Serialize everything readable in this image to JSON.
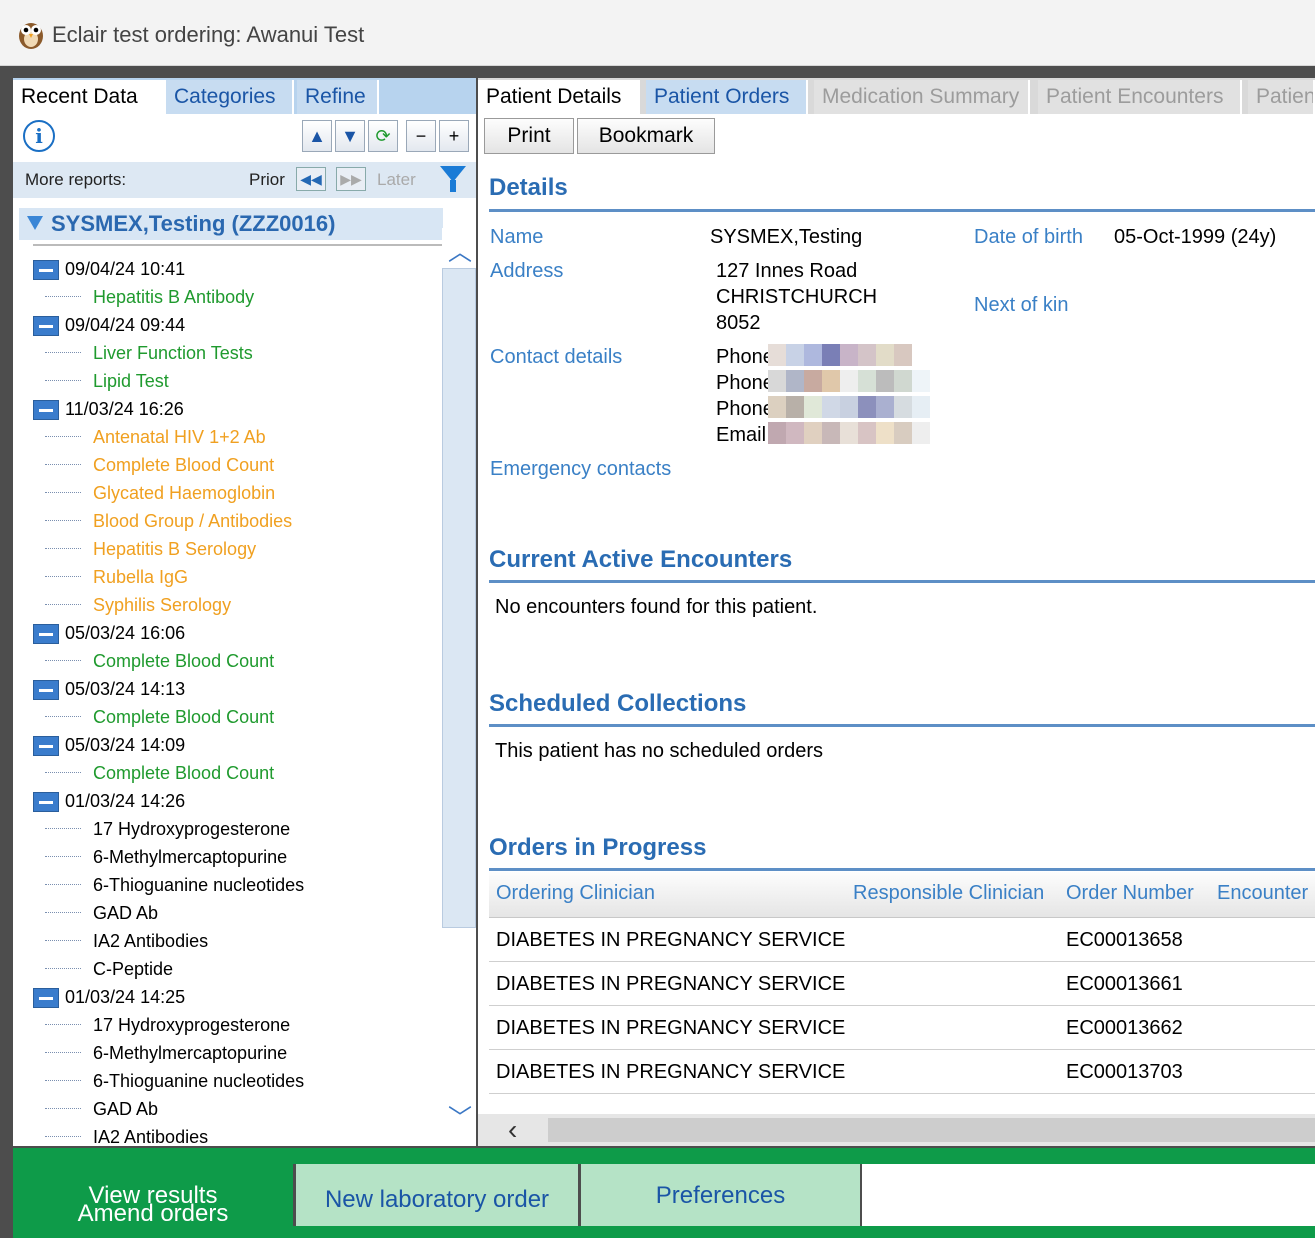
{
  "window": {
    "title": "Eclair test ordering: Awanui Test"
  },
  "left": {
    "tabs": [
      "Recent Data",
      "Categories",
      "Refine"
    ],
    "more_reports_label": "More reports:",
    "prior_label": "Prior",
    "later_label": "Later",
    "patient": "SYSMEX,Testing (ZZZ0016)",
    "tree": [
      {
        "date": "09/04/24 10:41",
        "items": [
          {
            "name": "Hepatitis B Antibody",
            "color": "green"
          }
        ]
      },
      {
        "date": "09/04/24 09:44",
        "items": [
          {
            "name": "Liver Function Tests",
            "color": "green"
          },
          {
            "name": "Lipid Test",
            "color": "green"
          }
        ]
      },
      {
        "date": "11/03/24 16:26",
        "items": [
          {
            "name": "Antenatal HIV 1+2 Ab",
            "color": "orange"
          },
          {
            "name": "Complete Blood Count",
            "color": "orange"
          },
          {
            "name": "Glycated Haemoglobin",
            "color": "orange"
          },
          {
            "name": "Blood Group / Antibodies",
            "color": "orange"
          },
          {
            "name": "Hepatitis B Serology",
            "color": "orange"
          },
          {
            "name": "Rubella IgG",
            "color": "orange"
          },
          {
            "name": "Syphilis Serology",
            "color": "orange"
          }
        ]
      },
      {
        "date": "05/03/24 16:06",
        "items": [
          {
            "name": "Complete Blood Count",
            "color": "green"
          }
        ]
      },
      {
        "date": "05/03/24 14:13",
        "items": [
          {
            "name": "Complete Blood Count",
            "color": "green"
          }
        ]
      },
      {
        "date": "05/03/24 14:09",
        "items": [
          {
            "name": "Complete Blood Count",
            "color": "green"
          }
        ]
      },
      {
        "date": "01/03/24 14:26",
        "items": [
          {
            "name": "17 Hydroxyprogesterone",
            "color": "black"
          },
          {
            "name": "6-Methylmercaptopurine",
            "color": "black"
          },
          {
            "name": "6-Thioguanine nucleotides",
            "color": "black"
          },
          {
            "name": "GAD Ab",
            "color": "black"
          },
          {
            "name": "IA2 Antibodies",
            "color": "black"
          },
          {
            "name": "C-Peptide",
            "color": "black"
          }
        ]
      },
      {
        "date": "01/03/24 14:25",
        "items": [
          {
            "name": "17 Hydroxyprogesterone",
            "color": "black"
          },
          {
            "name": "6-Methylmercaptopurine",
            "color": "black"
          },
          {
            "name": "6-Thioguanine nucleotides",
            "color": "black"
          },
          {
            "name": "GAD Ab",
            "color": "black"
          },
          {
            "name": "IA2 Antibodies",
            "color": "black"
          }
        ]
      }
    ]
  },
  "right": {
    "tabs": [
      "Patient Details",
      "Patient Orders",
      "Medication Summary",
      "Patient Encounters",
      "Patien"
    ],
    "buttons": {
      "print": "Print",
      "bookmark": "Bookmark"
    },
    "details": {
      "title": "Details",
      "name_label": "Name",
      "name": "SYSMEX,Testing",
      "dob_label": "Date of birth",
      "dob": "05-Oct-1999 (24y)",
      "address_label": "Address",
      "address_lines": [
        "127 Innes Road",
        "CHRISTCHURCH",
        "8052"
      ],
      "next_of_kin_label": "Next of kin",
      "contact_label": "Contact details",
      "contact_rows": [
        "Phone",
        "Phone",
        "Phone",
        "Email"
      ],
      "emergency_label": "Emergency contacts"
    },
    "encounters": {
      "title": "Current Active Encounters",
      "message": "No encounters found for this patient."
    },
    "scheduled": {
      "title": "Scheduled Collections",
      "message": "This patient has no scheduled orders"
    },
    "orders": {
      "title": "Orders in Progress",
      "columns": [
        "Ordering Clinician",
        "Responsible Clinician",
        "Order Number",
        "Encounter"
      ],
      "rows": [
        {
          "ordering": "DIABETES IN PREGNANCY SERVICE",
          "number": "EC00013658"
        },
        {
          "ordering": "DIABETES IN PREGNANCY SERVICE",
          "number": "EC00013661"
        },
        {
          "ordering": "DIABETES IN PREGNANCY SERVICE",
          "number": "EC00013662"
        },
        {
          "ordering": "DIABETES IN PREGNANCY SERVICE",
          "number": "EC00013703"
        }
      ]
    }
  },
  "bottom": {
    "view_results": "View results",
    "amend_orders": "Amend orders",
    "new_order": "New laboratory order",
    "preferences": "Preferences"
  },
  "colors": {
    "accent": "#2a6cb3",
    "green": "#1f9a2e",
    "orange": "#f0a020",
    "bottom_green": "#0e9b49"
  }
}
